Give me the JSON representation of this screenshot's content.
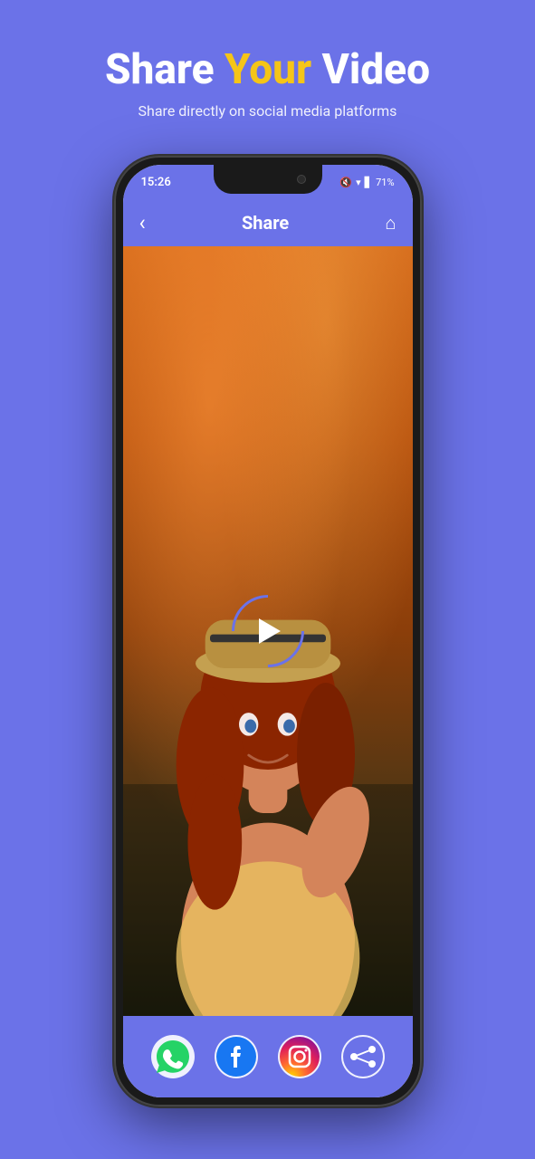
{
  "page": {
    "background_color": "#6B72E8"
  },
  "header": {
    "title_part1": "Share ",
    "title_highlight": "Your",
    "title_part2": " Video",
    "subtitle": "Share directly on social media platforms"
  },
  "phone": {
    "status_bar": {
      "time": "15:26",
      "battery": "71%",
      "icons": "notifications wifi signal battery"
    },
    "app_bar": {
      "title": "Share",
      "back_icon": "‹",
      "home_icon": "⌂"
    },
    "video": {
      "play_button_label": "Play"
    },
    "share_bar": {
      "icons": [
        {
          "name": "whatsapp",
          "label": "WhatsApp"
        },
        {
          "name": "facebook",
          "label": "Facebook"
        },
        {
          "name": "instagram",
          "label": "Instagram"
        },
        {
          "name": "share",
          "label": "Share"
        }
      ]
    }
  }
}
